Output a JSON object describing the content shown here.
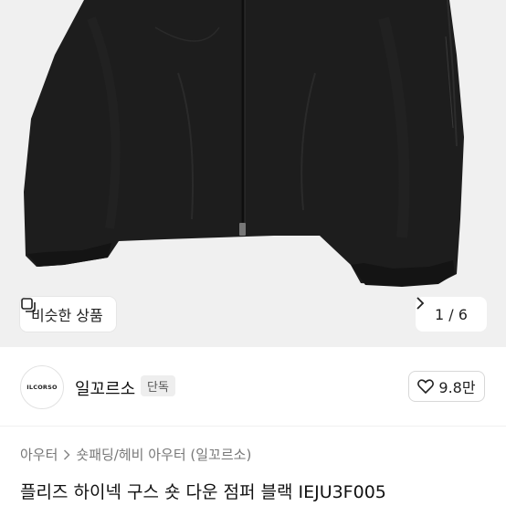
{
  "gallery": {
    "similar_label": "비슷한 상품",
    "pager": "1 / 6",
    "icons": {
      "similar": "similar-items-icon",
      "next": "chevron-right-icon"
    }
  },
  "shop": {
    "logo_text": "ILCORSO",
    "name": "일꼬르소",
    "badge": "단독",
    "likes": "9.8만",
    "like_icon": "heart-outline-icon"
  },
  "breadcrumb": {
    "items": [
      "아우터",
      "숏패딩/헤비 아우터 (일꼬르소)"
    ]
  },
  "product": {
    "title": "플리즈 하이넥 구스 숏 다운 점퍼 블랙 IEJU3F005"
  },
  "colors": {
    "jacket": "#1c1c1c",
    "background": "#f0f0f0",
    "badge_bg": "#eeeeee"
  }
}
